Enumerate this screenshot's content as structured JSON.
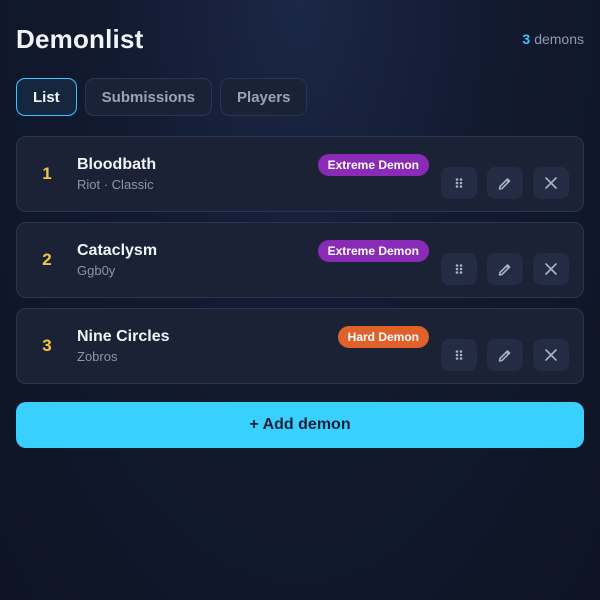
{
  "header": {
    "title": "Demonlist",
    "count_value": "3",
    "count_label": "demons"
  },
  "tabs": [
    {
      "label": "List",
      "active": true
    },
    {
      "label": "Submissions",
      "active": false
    },
    {
      "label": "Players",
      "active": false
    }
  ],
  "demons": [
    {
      "rank": "1",
      "name": "Bloodbath",
      "creator": "Riot · Classic",
      "difficulty": "Extreme Demon",
      "badge_color": "#8a2bb8"
    },
    {
      "rank": "2",
      "name": "Cataclysm",
      "creator": "Ggb0y",
      "difficulty": "Extreme Demon",
      "badge_color": "#8a2bb8"
    },
    {
      "rank": "3",
      "name": "Nine Circles",
      "creator": "Zobros",
      "difficulty": "Hard Demon",
      "badge_color": "#e0622a"
    }
  ],
  "icons": {
    "drag": "drag-handle-icon",
    "edit": "pencil-icon",
    "delete": "close-icon"
  },
  "colors": {
    "accent": "#38c6ff",
    "rank": "#f5c542",
    "add_button": "#38d0ff"
  },
  "add_button_label": "+ Add demon"
}
